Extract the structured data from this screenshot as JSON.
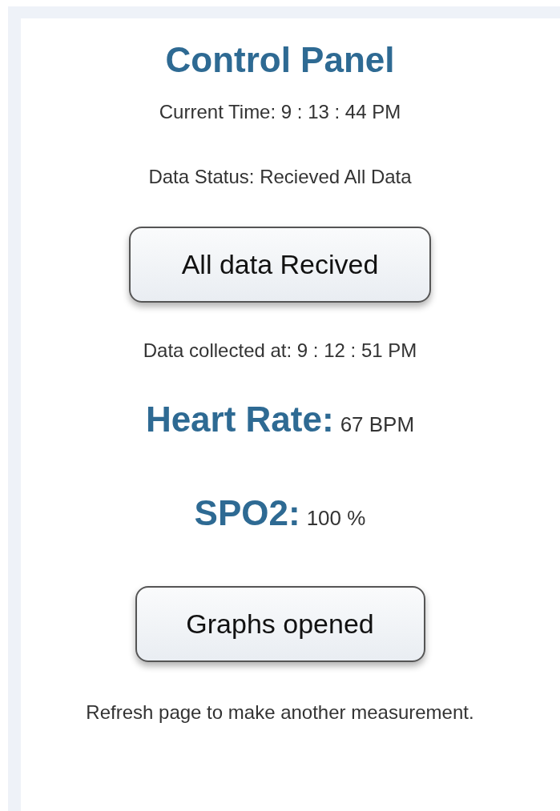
{
  "title": "Control Panel",
  "current_time": "Current Time: 9 : 13 : 44 PM",
  "data_status": "Data Status: Recieved All Data",
  "data_button": {
    "label": "All data Recived"
  },
  "collected_at": "Data collected at: 9 : 12 : 51 PM",
  "readings": [
    {
      "label": "Heart Rate:",
      "value": "67 BPM"
    },
    {
      "label": "SPO2:",
      "value": "100 %"
    }
  ],
  "graphs_button": {
    "label": "Graphs opened"
  },
  "footer_note": "Refresh page to make another measurement."
}
